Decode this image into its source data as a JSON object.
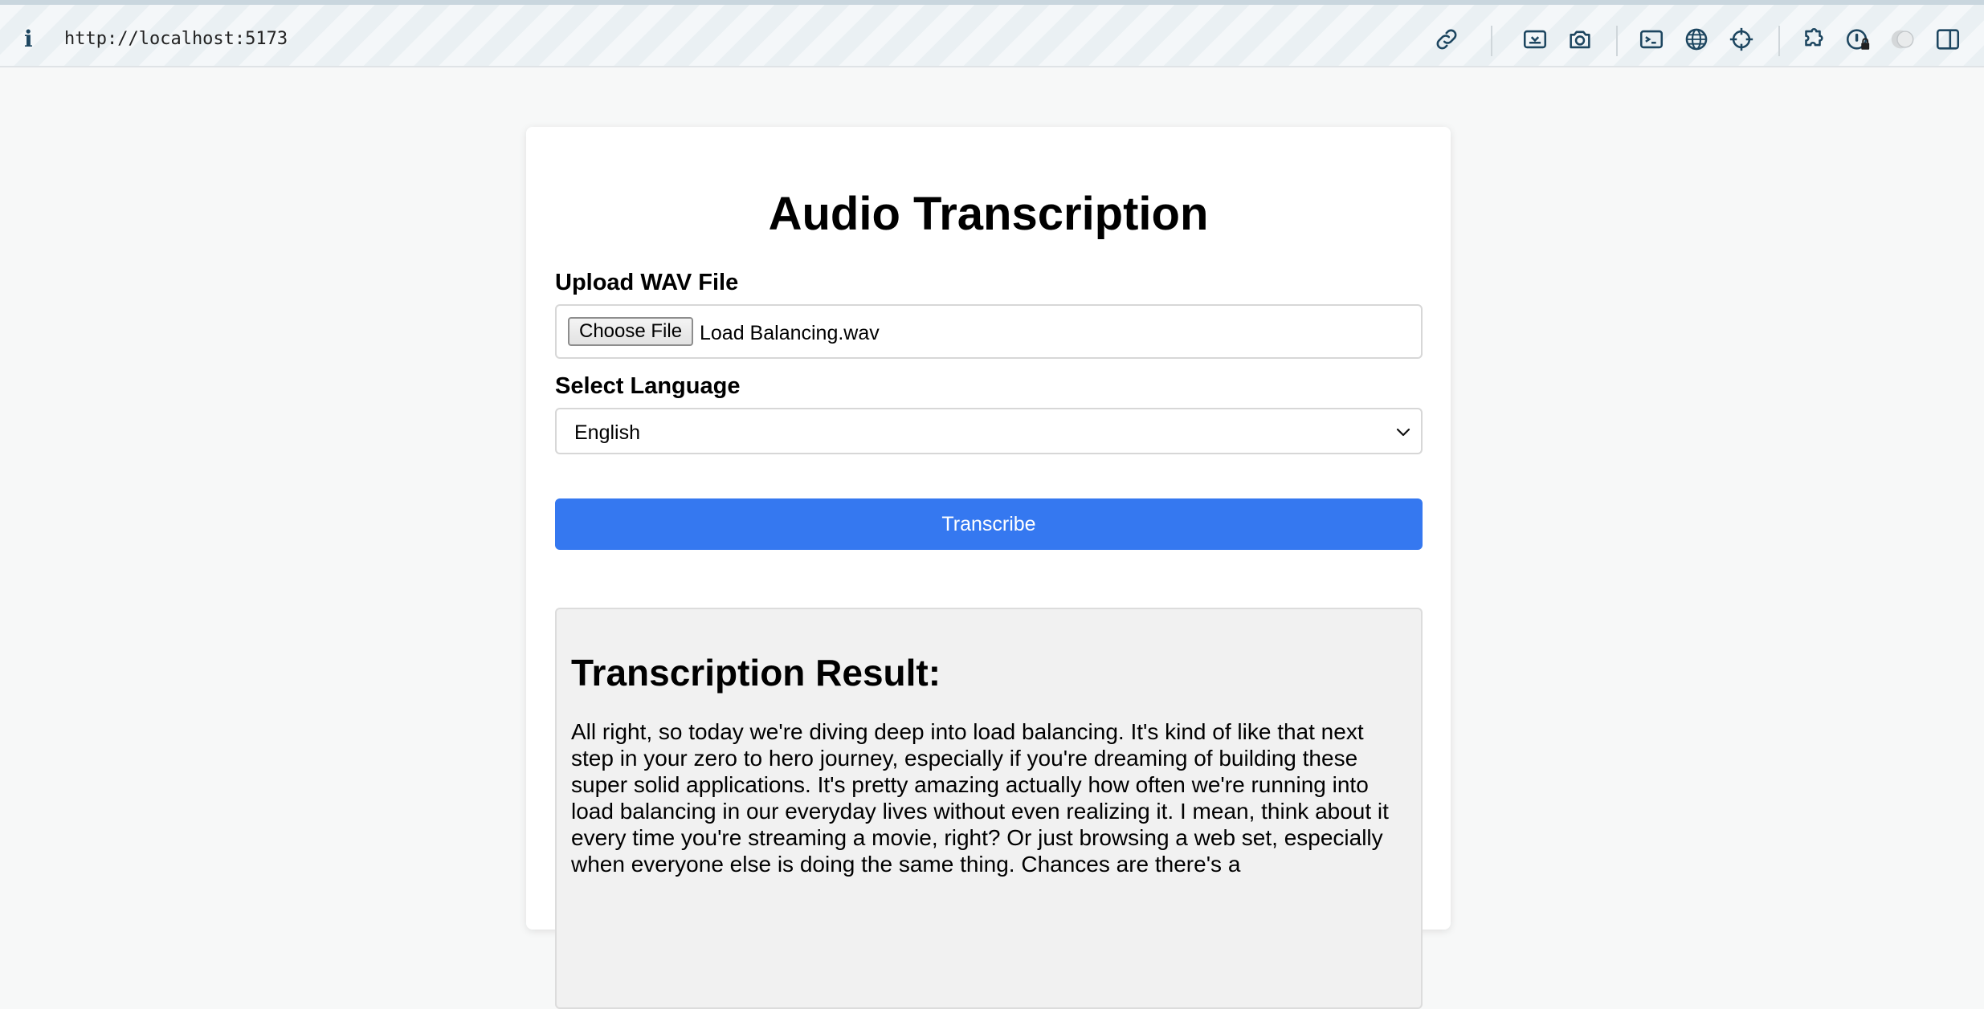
{
  "browser": {
    "url": "http://localhost:5173"
  },
  "page": {
    "title": "Audio Transcription",
    "upload": {
      "label": "Upload WAV File",
      "button_label": "Choose File",
      "file_name": "Load Balancing.wav"
    },
    "language": {
      "label": "Select Language",
      "selected": "English"
    },
    "transcribe_button": "Transcribe",
    "result": {
      "heading": "Transcription Result:",
      "text": "All right, so today we're diving deep into load balancing. It's kind of like that next step in your zero to hero journey, especially if you're dreaming of building these super solid applications. It's pretty amazing actually how often we're running into load balancing in our everyday lives without even realizing it. I mean, think about it every time you're streaming a movie, right? Or just browsing a web set, especially when everyone else is doing the same thing. Chances are there's a"
    }
  },
  "colors": {
    "primary_button": "#3578f0",
    "result_background": "#f1f1f1",
    "page_background": "#f7f8f8"
  },
  "icons": [
    "info-icon",
    "link-icon",
    "screen-capture-icon",
    "camera-icon",
    "terminal-icon",
    "globe-icon",
    "crosshair-icon",
    "extensions-icon",
    "password-manager-icon",
    "profile-icon",
    "sidebar-icon",
    "chevron-down-icon"
  ]
}
